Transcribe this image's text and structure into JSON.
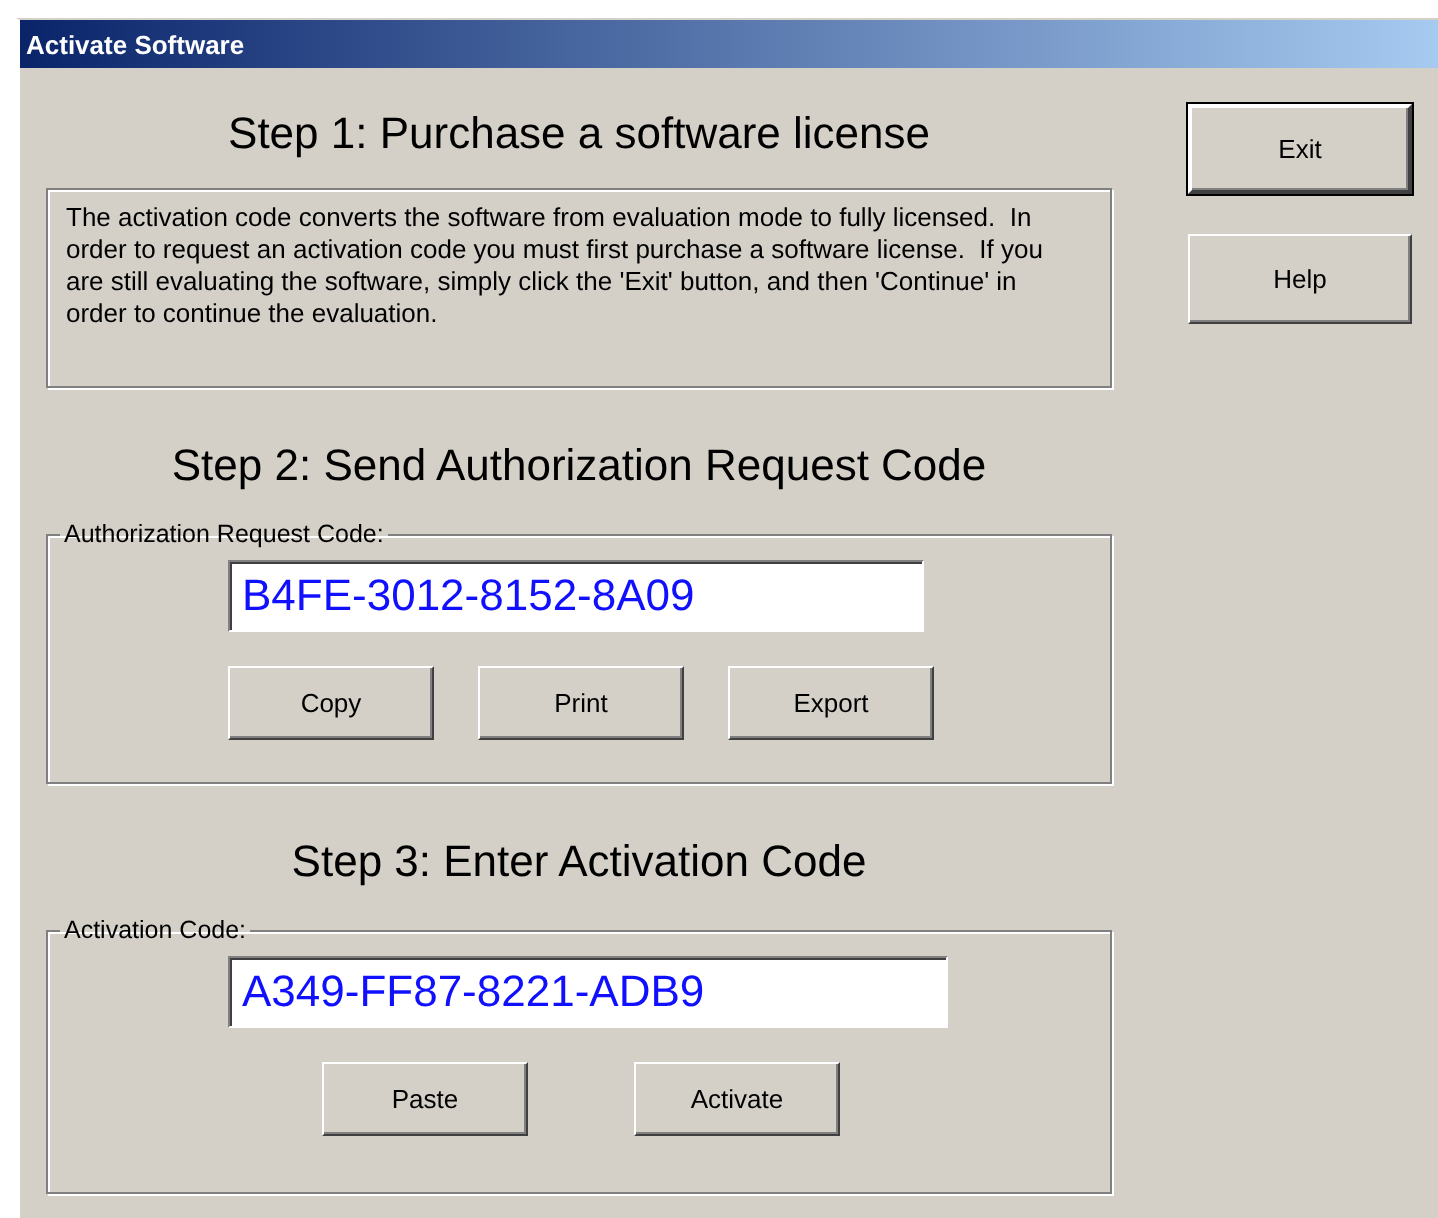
{
  "window": {
    "title": "Activate Software"
  },
  "side_buttons": [
    {
      "label": "Exit",
      "default": true
    },
    {
      "label": "Help",
      "default": false
    }
  ],
  "step1": {
    "heading": "Step 1: Purchase a software license",
    "text": "The activation code converts the software from evaluation mode to fully licensed.  In order to request an activation code you must first purchase a software license.  If you are still evaluating the software, simply click the 'Exit' button, and then 'Continue' in order to continue the evaluation."
  },
  "step2": {
    "heading": "Step 2: Send Authorization Request Code",
    "group_label": "Authorization Request Code:",
    "code": "B4FE-3012-8152-8A09",
    "buttons": [
      {
        "label": "Copy",
        "default": false
      },
      {
        "label": "Print",
        "default": false
      },
      {
        "label": "Export",
        "default": false
      }
    ]
  },
  "step3": {
    "heading": "Step 3: Enter Activation Code",
    "group_label": "Activation Code:",
    "code": "A349-FF87-8221-ADB9",
    "buttons": [
      {
        "label": "Paste",
        "default": false
      },
      {
        "label": "Activate",
        "default": false
      }
    ]
  }
}
